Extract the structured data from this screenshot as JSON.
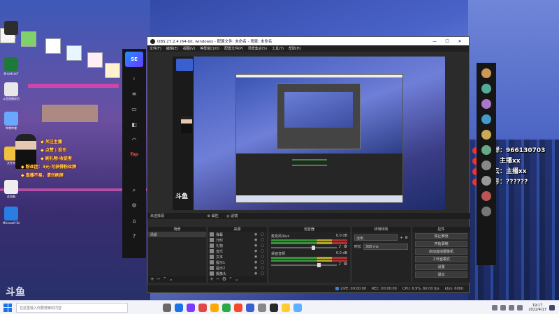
{
  "window": {
    "title": "OBS 27.2.4 (64-bit, windows) - 配置文件: 未命名 - 场景: 未命名",
    "menu": [
      "文件(F)",
      "编辑(E)",
      "视图(V)",
      "停靠窗口(D)",
      "配置文件(P)",
      "场景集合(S)",
      "工具(T)",
      "帮助(H)"
    ],
    "minimize": "—",
    "maximize": "☐",
    "close": "✕"
  },
  "desktop": {
    "icons": [
      {
        "label": "xiaoyu",
        "color": "#2d2d2d"
      },
      {
        "label": "BroadcasT",
        "color": "#1d7a3b"
      },
      {
        "label": "斗鱼直播伴侣",
        "color": "#e8e8e8"
      },
      {
        "label": "哔哩哔哩",
        "color": "#6aa8ff"
      },
      {
        "label": "文件夹",
        "color": "#f0c040"
      },
      {
        "label": "此电脑",
        "color": "#eeeeee"
      },
      {
        "label": "Microsoft Edge",
        "color": "#2a7de1"
      }
    ]
  },
  "overlay": {
    "lines": [
      "◆ 关注主播",
      "◆ 点赞 | 投币",
      "◆ 刷礼物·收徒者",
      "◆ 粉丝团：3元·可获得粉丝牌",
      "◆ 直播不易，请勿刷屏"
    ],
    "stats": [
      {
        "label": "粉丝群：",
        "value": "966130703"
      },
      {
        "label": "微博：",
        "value": "主播xx"
      },
      {
        "label": "网易云：",
        "value": "主播xx"
      },
      {
        "label": "房间号：",
        "value": "??????"
      }
    ]
  },
  "side_panel": {
    "logo": "SE",
    "top_tag": "Top"
  },
  "obs": {
    "dock_header": "未选择源",
    "dock_header_buttons": [
      "⚙ 属性",
      "◎ 滤镜"
    ],
    "scenes_title": "场景",
    "scenes": [
      "场景"
    ],
    "sources_title": "来源",
    "sources": [
      "弹幕",
      "计时",
      "礼物",
      "音乐",
      "文本",
      "提示1",
      "提示2",
      "摄像头",
      "桌面"
    ],
    "mixer_title": "混音器",
    "mixer": [
      {
        "name": "麦克风/Aux",
        "db": "0.0 dB",
        "level": 0.62
      },
      {
        "name": "桌面音频",
        "db": "0.0 dB",
        "level": 0.7
      }
    ],
    "transitions_title": "转场特效",
    "transition": "淡出",
    "duration_label": "时长",
    "duration": "300 ms",
    "controls_title": "控件",
    "controls": [
      "停止推流",
      "开始录制",
      "启动虚拟摄像机",
      "工作室模式",
      "设置",
      "退出"
    ],
    "status": {
      "live_label": "LIVE:",
      "live_time": "00:00:00",
      "rec_label": "REC:",
      "rec_time": "00:00:00",
      "cpu": "CPU: 6.9%, 60.00 fps",
      "kbps": "kb/s: 6000"
    }
  },
  "preview": {
    "logo_text": "斗鱼"
  },
  "watermark": "斗鱼",
  "taskbar": {
    "search_placeholder": "在这里输入你要搜索的内容",
    "apps": [
      "#6a6a6a",
      "#1a73e8",
      "#7a3cff",
      "#e04848",
      "#ffaa00",
      "#2aa84a",
      "#f54a2a",
      "#3a5fd0",
      "#888888",
      "#2a2a2a",
      "#ffcc33",
      "#5fb0ff"
    ],
    "date_line1": "19:17",
    "date_line2": "2022/4/17"
  }
}
